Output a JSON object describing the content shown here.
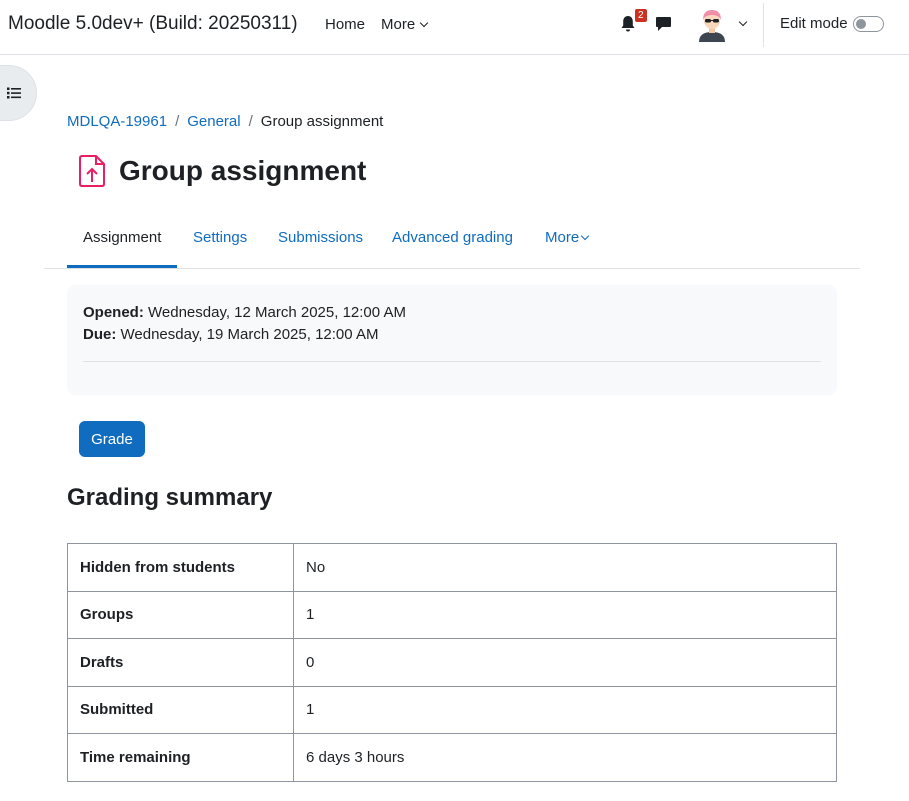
{
  "navbar": {
    "brand": "Moodle 5.0dev+ (Build: 20250311)",
    "home": "Home",
    "more": "More",
    "notification_count": "2",
    "edit_mode": "Edit mode"
  },
  "breadcrumb": {
    "course": "MDLQA-19961",
    "section": "General",
    "current": "Group assignment",
    "separator": "/"
  },
  "page": {
    "title": "Group assignment"
  },
  "tabs": [
    {
      "label": "Assignment"
    },
    {
      "label": "Settings"
    },
    {
      "label": "Submissions"
    },
    {
      "label": "Advanced grading"
    },
    {
      "label": "More"
    }
  ],
  "dates": {
    "opened_label": "Opened:",
    "opened_value": " Wednesday, 12 March 2025, 12:00 AM",
    "due_label": "Due:",
    "due_value": " Wednesday, 19 March 2025, 12:00 AM"
  },
  "grade_button": "Grade",
  "summary": {
    "heading": "Grading summary",
    "rows": [
      {
        "key": "Hidden from students",
        "value": "No"
      },
      {
        "key": "Groups",
        "value": "1"
      },
      {
        "key": "Drafts",
        "value": "0"
      },
      {
        "key": "Submitted",
        "value": "1"
      },
      {
        "key": "Time remaining",
        "value": "6 days 3 hours"
      }
    ]
  },
  "colors": {
    "primary": "#0f6cbf",
    "assignment_icon": "#e91e63",
    "badge": "#ca3120"
  }
}
